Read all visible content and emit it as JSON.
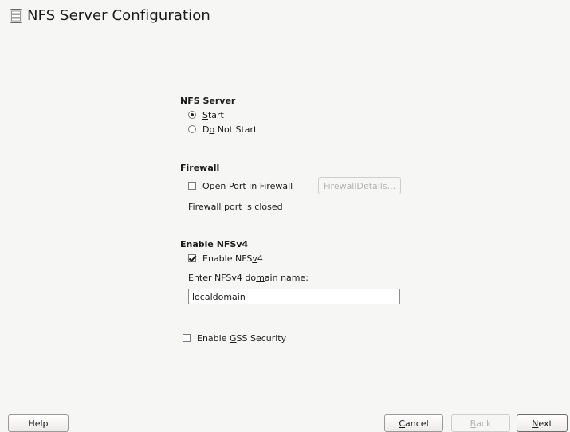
{
  "header": {
    "title": "NFS Server Configuration",
    "icon": "server-icon"
  },
  "nfs_server": {
    "label": "NFS Server",
    "start": {
      "pre": "",
      "mn": "S",
      "post": "tart",
      "checked": true
    },
    "do_not_start": {
      "pre": "D",
      "mn": "o",
      "post": " Not Start",
      "checked": false
    }
  },
  "firewall": {
    "label": "Firewall",
    "open_port": {
      "pre": "Open Port in ",
      "mn": "F",
      "post": "irewall",
      "checked": false
    },
    "details_button": {
      "pre": "Firewall ",
      "mn": "D",
      "post": "etails...",
      "enabled": false
    },
    "status": "Firewall port is closed"
  },
  "nfsv4": {
    "label": "Enable NFSv4",
    "enable": {
      "pre": "Enable NFS",
      "mn": "v",
      "post": "4",
      "checked": true
    },
    "domain_label": {
      "pre": "Enter NFSv4 do",
      "mn": "m",
      "post": "ain name:"
    },
    "domain_value": "localdomain"
  },
  "gss": {
    "pre": "Enable ",
    "mn": "G",
    "post": "SS Security",
    "checked": false
  },
  "footer": {
    "help": "Help",
    "cancel": {
      "pre": "",
      "mn": "C",
      "post": "ancel"
    },
    "back": {
      "pre": "",
      "mn": "B",
      "post": "ack",
      "enabled": false
    },
    "next": {
      "pre": "",
      "mn": "N",
      "post": "ext"
    }
  }
}
